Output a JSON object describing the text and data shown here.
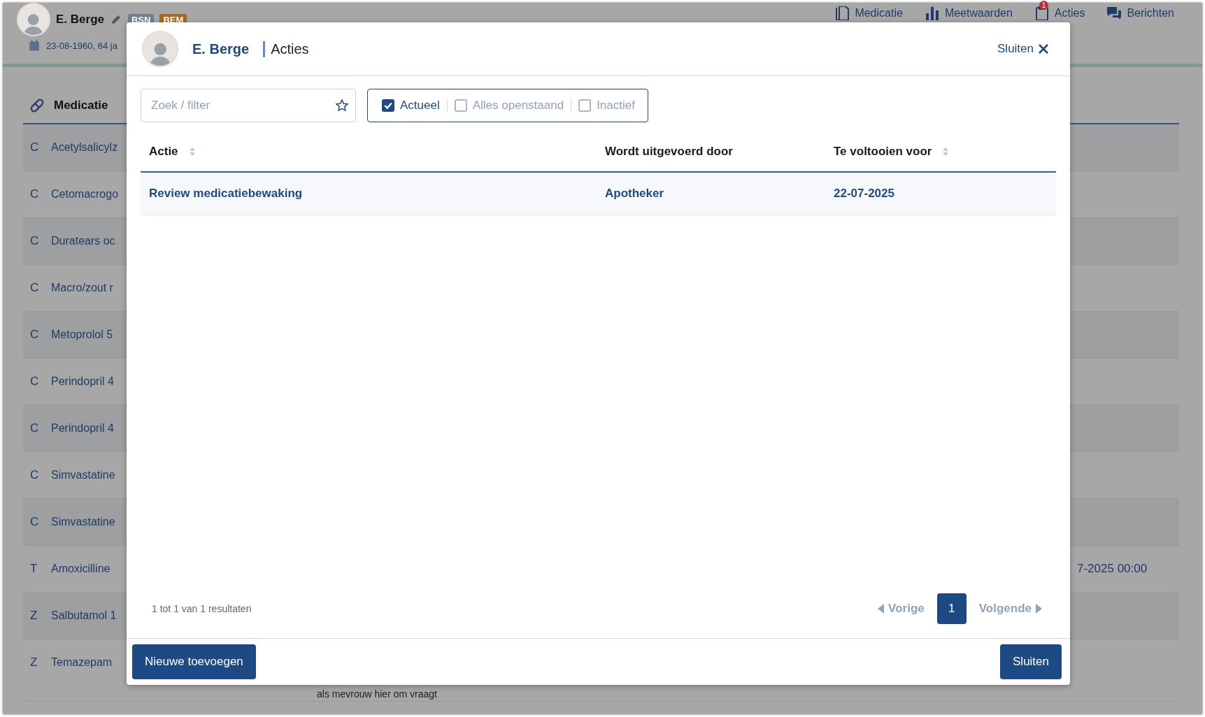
{
  "patient_header": {
    "name": "E. Berge",
    "badges": [
      {
        "label": "BSN",
        "color": "#6e7f95"
      },
      {
        "label": "BEM",
        "color": "#a8661a"
      }
    ],
    "birth_info": "23-08-1960, 64 ja"
  },
  "nav": [
    {
      "label": "Medicatie"
    },
    {
      "label": "Meetwaarden"
    },
    {
      "label": "Acties",
      "badge": "1"
    },
    {
      "label": "Berichten"
    }
  ],
  "medication_panel": {
    "title": "Medicatie",
    "rows": [
      {
        "type": "C",
        "name": "Acetylsalicylz"
      },
      {
        "type": "C",
        "name": "Cetomacrogo"
      },
      {
        "type": "C",
        "name": "Duratears oc"
      },
      {
        "type": "C",
        "name": "Macro/zout r"
      },
      {
        "type": "C",
        "name": "Metoprolol 5"
      },
      {
        "type": "C",
        "name": "Perindopril 4"
      },
      {
        "type": "C",
        "name": "Perindopril 4"
      },
      {
        "type": "C",
        "name": "Simvastatine"
      },
      {
        "type": "C",
        "name": "Simvastatine"
      },
      {
        "type": "T",
        "name": "Amoxicilline",
        "end": "7-2025 00:00"
      },
      {
        "type": "Z",
        "name": "Salbutamol 1"
      },
      {
        "type": "Z",
        "name": "Temazepam",
        "note": "als mevrouw hier om vraagt"
      }
    ]
  },
  "dialog": {
    "patient": "E. Berge",
    "title": "Acties",
    "close_link": "Sluiten",
    "search": {
      "placeholder": "Zoek / filter"
    },
    "filters": [
      {
        "label": "Actueel",
        "checked": true
      },
      {
        "label": "Alles openstaand",
        "checked": false
      },
      {
        "label": "Inactief",
        "checked": false
      }
    ],
    "table": {
      "columns": [
        {
          "label": "Actie",
          "sortable": true
        },
        {
          "label": "Wordt uitgevoerd door",
          "sortable": false
        },
        {
          "label": "Te voltooien voor",
          "sortable": true
        }
      ],
      "rows": [
        [
          "Review medicatiebewaking",
          "Apotheker",
          "22-07-2025"
        ]
      ]
    },
    "result_count": "1 tot 1 van 1 resultaten",
    "pagination": {
      "previous": {
        "label": "Vorige",
        "disabled": true
      },
      "pages": [
        {
          "label": "1",
          "selected": true
        }
      ],
      "next": {
        "label": "Volgende",
        "disabled": true
      }
    },
    "buttons": [
      "Nieuwe toevoegen",
      "Sluiten"
    ]
  }
}
